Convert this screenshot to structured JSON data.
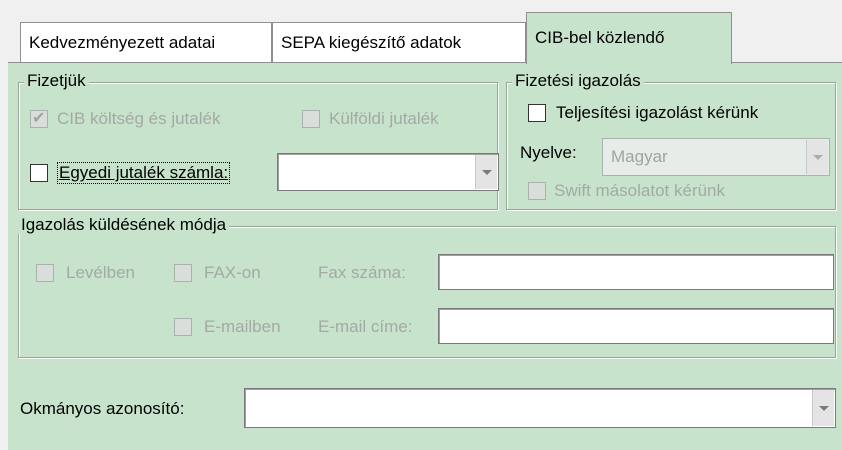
{
  "tabs": [
    {
      "label": "Kedvezményezett adatai"
    },
    {
      "label": "SEPA kiegészítő adatok"
    },
    {
      "label": "CIB-bel közlendő"
    }
  ],
  "fizetjuk": {
    "legend": "Fizetjük",
    "cib_cost_label": "CIB költség és jutalék",
    "cib_cost_checked": true,
    "foreign_fee_label": "Külföldi jutalék",
    "foreign_fee_checked": false,
    "custom_fee_label": "Egyedi jutalék számla:",
    "custom_fee_checked": false,
    "custom_fee_value": ""
  },
  "fizetesi_igazolas": {
    "legend": "Fizetési igazolás",
    "request_label": "Teljesítési igazolást kérünk",
    "request_checked": false,
    "language_label": "Nyelve:",
    "language_value": "Magyar",
    "swift_label": "Swift másolatot kérünk",
    "swift_checked": false
  },
  "igazolas_kuldes": {
    "legend": "Igazolás küldésének módja",
    "letter_label": "Levélben",
    "fax_label": "FAX-on",
    "fax_number_label": "Fax száma:",
    "fax_number_value": "",
    "email_label": "E-mailben",
    "email_address_label": "E-mail címe:",
    "email_address_value": ""
  },
  "document_id": {
    "label": "Okmányos azonosító:",
    "value": ""
  }
}
